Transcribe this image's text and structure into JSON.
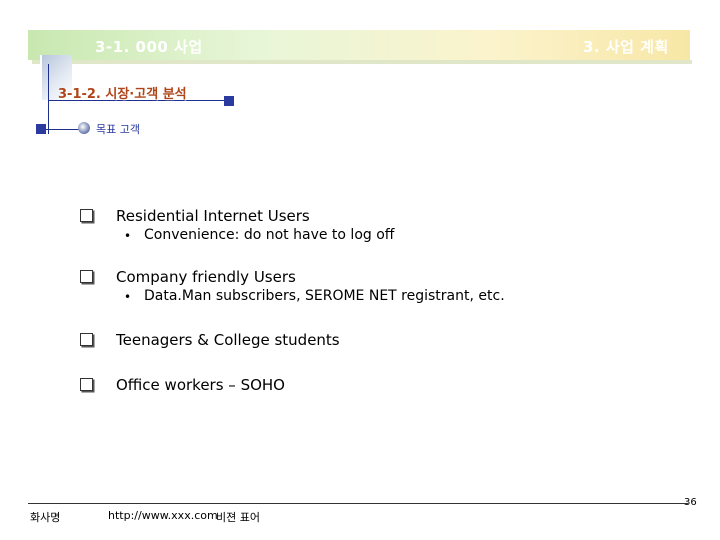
{
  "header": {
    "section_title": "3-1. 000 사업",
    "chapter_title": "3. 사업 계획",
    "subsection_title": "3-1-2. 시장·고객 분석",
    "target_label": "목표 고객"
  },
  "items": [
    {
      "title": "Residential Internet Users",
      "sub": "Convenience: do not have to log off"
    },
    {
      "title": "Company friendly Users",
      "sub": "Data.Man subscribers, SEROME NET registrant, etc."
    },
    {
      "title": "Teenagers & College students"
    },
    {
      "title": "Office workers – SOHO"
    }
  ],
  "sub_bullet": "•",
  "footer": {
    "company": "화사명",
    "url": "http://www.xxx.com",
    "vision": "비젼 표어",
    "page_number": "36"
  },
  "colors": {
    "accent_navy": "#2a3a9e",
    "subsection_orange": "#b0451a",
    "banner_green": "#c8e8b0",
    "banner_yellow": "#f7e7a6"
  }
}
